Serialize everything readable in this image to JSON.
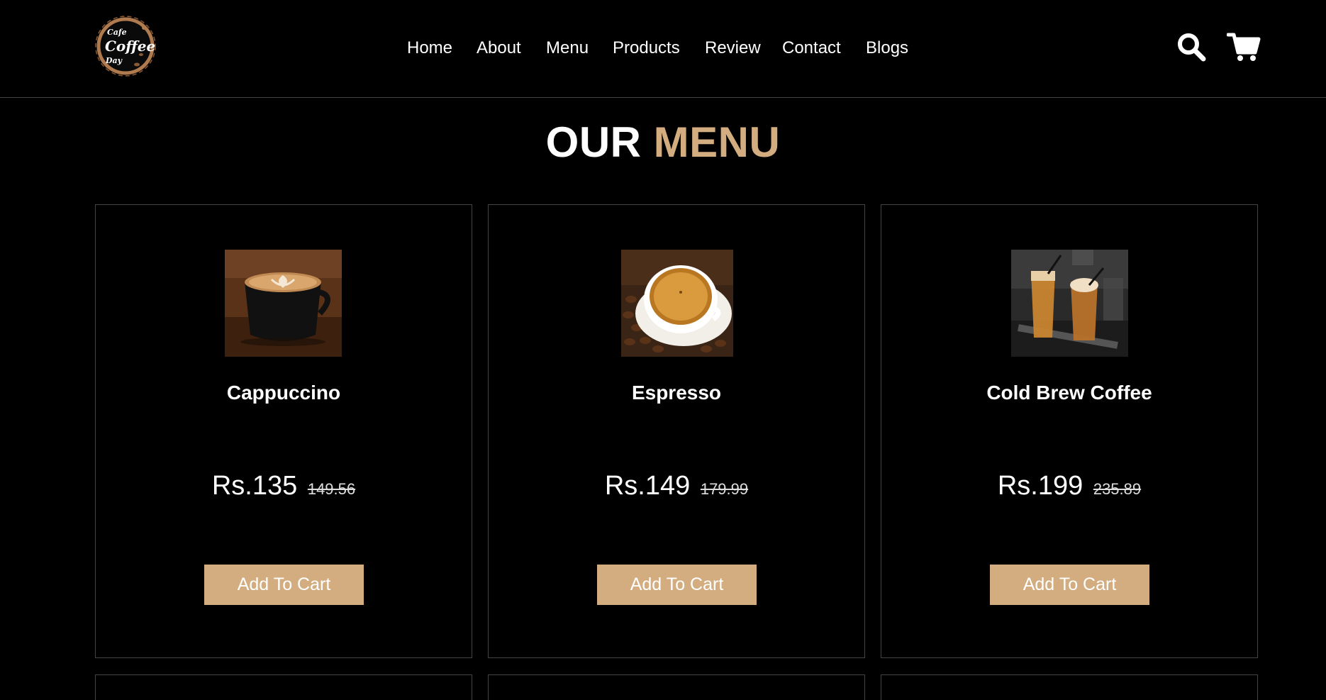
{
  "brand": {
    "logo_line1": "Cafe",
    "logo_line2": "Coffee",
    "logo_line3": "Day",
    "colors": {
      "accent": "#d3ad7f",
      "background": "#000000",
      "border": "#444444"
    }
  },
  "nav": {
    "items": [
      {
        "label": "Home"
      },
      {
        "label": "About"
      },
      {
        "label": "Menu"
      },
      {
        "label": "Products"
      },
      {
        "label": "Review"
      },
      {
        "label": "Contact"
      },
      {
        "label": "Blogs"
      }
    ],
    "icons": [
      "search-icon",
      "cart-icon"
    ]
  },
  "section": {
    "title_part1": "OUR",
    "title_part2": "MENU"
  },
  "menu_items": [
    {
      "name": "Cappuccino",
      "price": "Rs.135",
      "old_price": "149.56",
      "button": "Add To Cart",
      "image": "cappuccino-image"
    },
    {
      "name": "Espresso",
      "price": "Rs.149",
      "old_price": "179.99",
      "button": "Add To Cart",
      "image": "espresso-image"
    },
    {
      "name": "Cold Brew Coffee",
      "price": "Rs.199",
      "old_price": "235.89",
      "button": "Add To Cart",
      "image": "cold-brew-image"
    }
  ]
}
